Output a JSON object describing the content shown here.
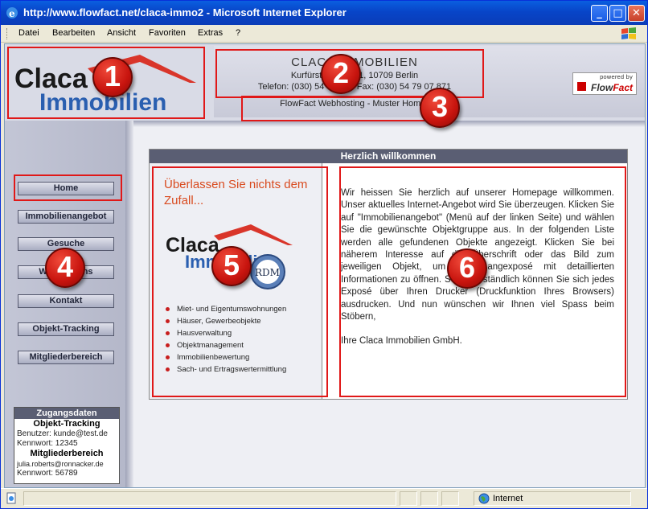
{
  "window": {
    "title": "http://www.flowfact.net/claca-immo2 - Microsoft Internet Explorer",
    "buttons": {
      "minimize": "_",
      "maximize": "□",
      "close": "✕"
    }
  },
  "menu": [
    "Datei",
    "Bearbeiten",
    "Ansicht",
    "Favoriten",
    "Extras",
    "?"
  ],
  "header": {
    "logo_text_top": "Claca",
    "logo_text_bottom": "Immobilien",
    "company_name": "CLACA IMMOBILIEN",
    "address": "Kurfürstendamm 1, 10709 Berlin",
    "phone": "Telefon: (030) 54 79 07 - Fax: (030) 54 79 07 871",
    "webhosting": "FlowFact Webhosting - Muster Homepage",
    "powered_by": "powered by",
    "powered_brand_a": "Flow",
    "powered_brand_b": "Fact"
  },
  "nav": [
    "Home",
    "Immobilienangebot",
    "Gesuche",
    "Wir über uns",
    "Kontakt",
    "Objekt-Tracking",
    "Mitgliederbereich"
  ],
  "access": {
    "title": "Zugangsdaten",
    "tracking_title": "Objekt-Tracking",
    "tracking_user": "Benutzer: kunde@test.de",
    "tracking_password": "Kennwort: 12345",
    "member_title": "Mitgliederbereich",
    "member_user": "julia.roberts@ronnacker.de",
    "member_password": "Kennwort: 56789"
  },
  "panel": {
    "title": "Herzlich willkommen",
    "slogan": "Überlassen Sie nichts dem Zufall...",
    "logo_text_top": "Claca",
    "logo_text_bottom": "Immobilien",
    "rdm": "RDM",
    "services": [
      "Miet- und Eigentumswohnungen",
      "Häuser, Gewerbeobjekte",
      "Hausverwaltung",
      "Objektmanagement",
      "Immobilienbewertung",
      "Sach- und Ertragswertermittlung"
    ],
    "welcome_text": "Wir heissen Sie herzlich auf unserer Homepage willkommen. Unser aktuelles Internet-Angebot wird Sie überzeugen. Klicken Sie auf \"Immobilienangebot\" (Menü auf der linken Seite) und wählen Sie die gewünschte Objektgruppe aus. In der folgenden Liste werden alle gefundenen Objekte angezeigt. Klicken Sie bei näherem Interesse auf die Überschrift oder das Bild zum jeweiligen Objekt, um das Langexposé mit detaillierten Informationen zu öffnen. Selbstverständlich können Sie sich jedes Exposé über Ihren Drucker (Druckfunktion Ihres Browsers) ausdrucken. Und nun wünschen wir Ihnen viel Spass beim Stöbern,",
    "signature": "Ihre Claca Immobilien GmbH."
  },
  "badges": [
    "1",
    "2",
    "3",
    "4",
    "5",
    "6"
  ],
  "status": {
    "zone": "Internet"
  },
  "colors": {
    "accent_red": "#e01818",
    "slogan": "#d94a1e",
    "panel_bar": "#5a5e73",
    "logo_blue": "#2a5fb0"
  }
}
